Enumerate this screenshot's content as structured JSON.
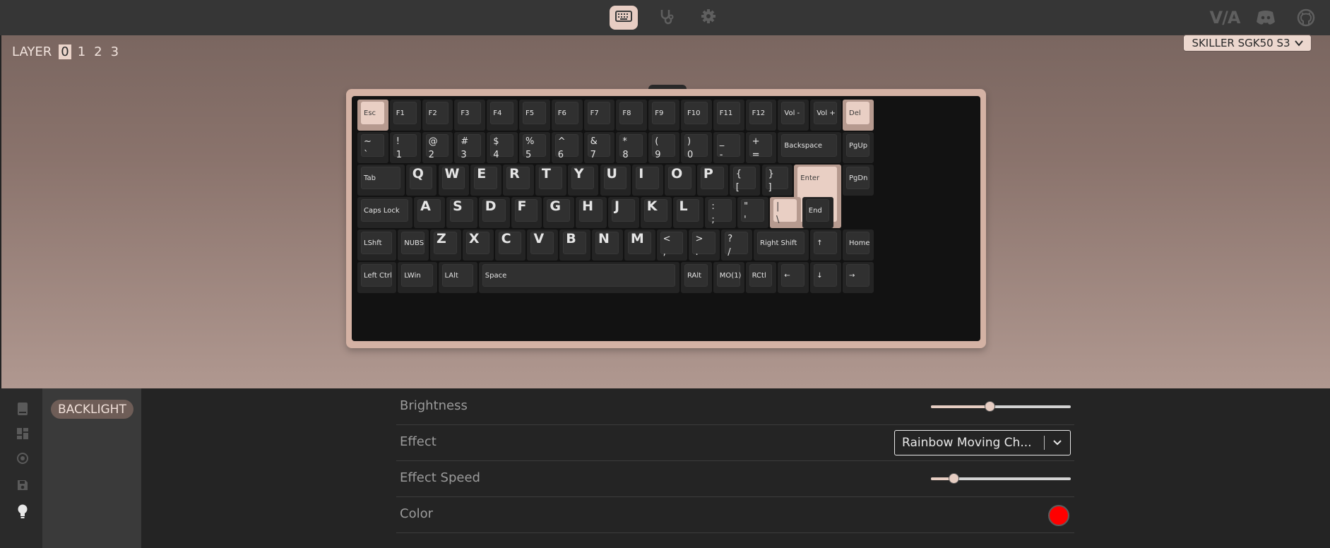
{
  "nav": {
    "configure_icon": "keyboard-icon",
    "test_icon": "stethoscope-icon",
    "settings_icon": "gear-icon",
    "via_logo": "V/A",
    "discord_icon": "discord-icon",
    "github_icon": "github-icon"
  },
  "layer": {
    "label": "LAYER",
    "layers": [
      "0",
      "1",
      "2",
      "3"
    ],
    "selected": "0"
  },
  "device": {
    "name": "SKILLER SGK50 S3"
  },
  "keyboard": {
    "row1": [
      "Esc",
      "F1",
      "F2",
      "F3",
      "F4",
      "F5",
      "F6",
      "F7",
      "F8",
      "F9",
      "F10",
      "F11",
      "F12",
      "Vol -",
      "Vol +",
      "Del"
    ],
    "row2": [
      "~\n`",
      "!\n1",
      "@\n2",
      "#\n3",
      "$\n4",
      "%\n5",
      "^\n6",
      "&\n7",
      "*\n8",
      "(\n9",
      ")\n0",
      "_\n-",
      "+\n=",
      "Backspace",
      "PgUp"
    ],
    "row3": [
      "Tab",
      "Q",
      "W",
      "E",
      "R",
      "T",
      "Y",
      "U",
      "I",
      "O",
      "P",
      "{\n[",
      "}\n]",
      "Enter",
      "PgDn"
    ],
    "row4": [
      "Caps Lock",
      "A",
      "S",
      "D",
      "F",
      "G",
      "H",
      "J",
      "K",
      "L",
      ":\n;",
      "\"\n'",
      "|\n\\",
      "End"
    ],
    "row5": [
      "LShft",
      "NUBS",
      "Z",
      "X",
      "C",
      "V",
      "B",
      "N",
      "M",
      "<\n,",
      ">\n.",
      "?\n/",
      "Right Shift",
      "↑",
      "Home"
    ],
    "row6": [
      "Left Ctrl",
      "LWin",
      "LAlt",
      "Space",
      "RAlt",
      "MO(1)",
      "RCtl",
      "←",
      "↓",
      "→"
    ]
  },
  "sidebar": {
    "icons": [
      "book-icon",
      "grid-icon",
      "macro-icon",
      "save-icon",
      "lightbulb-icon"
    ],
    "active_menu": "BACKLIGHT"
  },
  "backlight": {
    "brightness_label": "Brightness",
    "brightness_value": 0.42,
    "effect_label": "Effect",
    "effect_value": "Rainbow Moving Ch...",
    "speed_label": "Effect Speed",
    "speed_value": 0.16,
    "color_label": "Color",
    "color_value": "#ff0000"
  },
  "colors": {
    "accent": "#e7cdc3",
    "keycap_dark": "#303030",
    "keycap_highlight": "#e9cfc4"
  }
}
